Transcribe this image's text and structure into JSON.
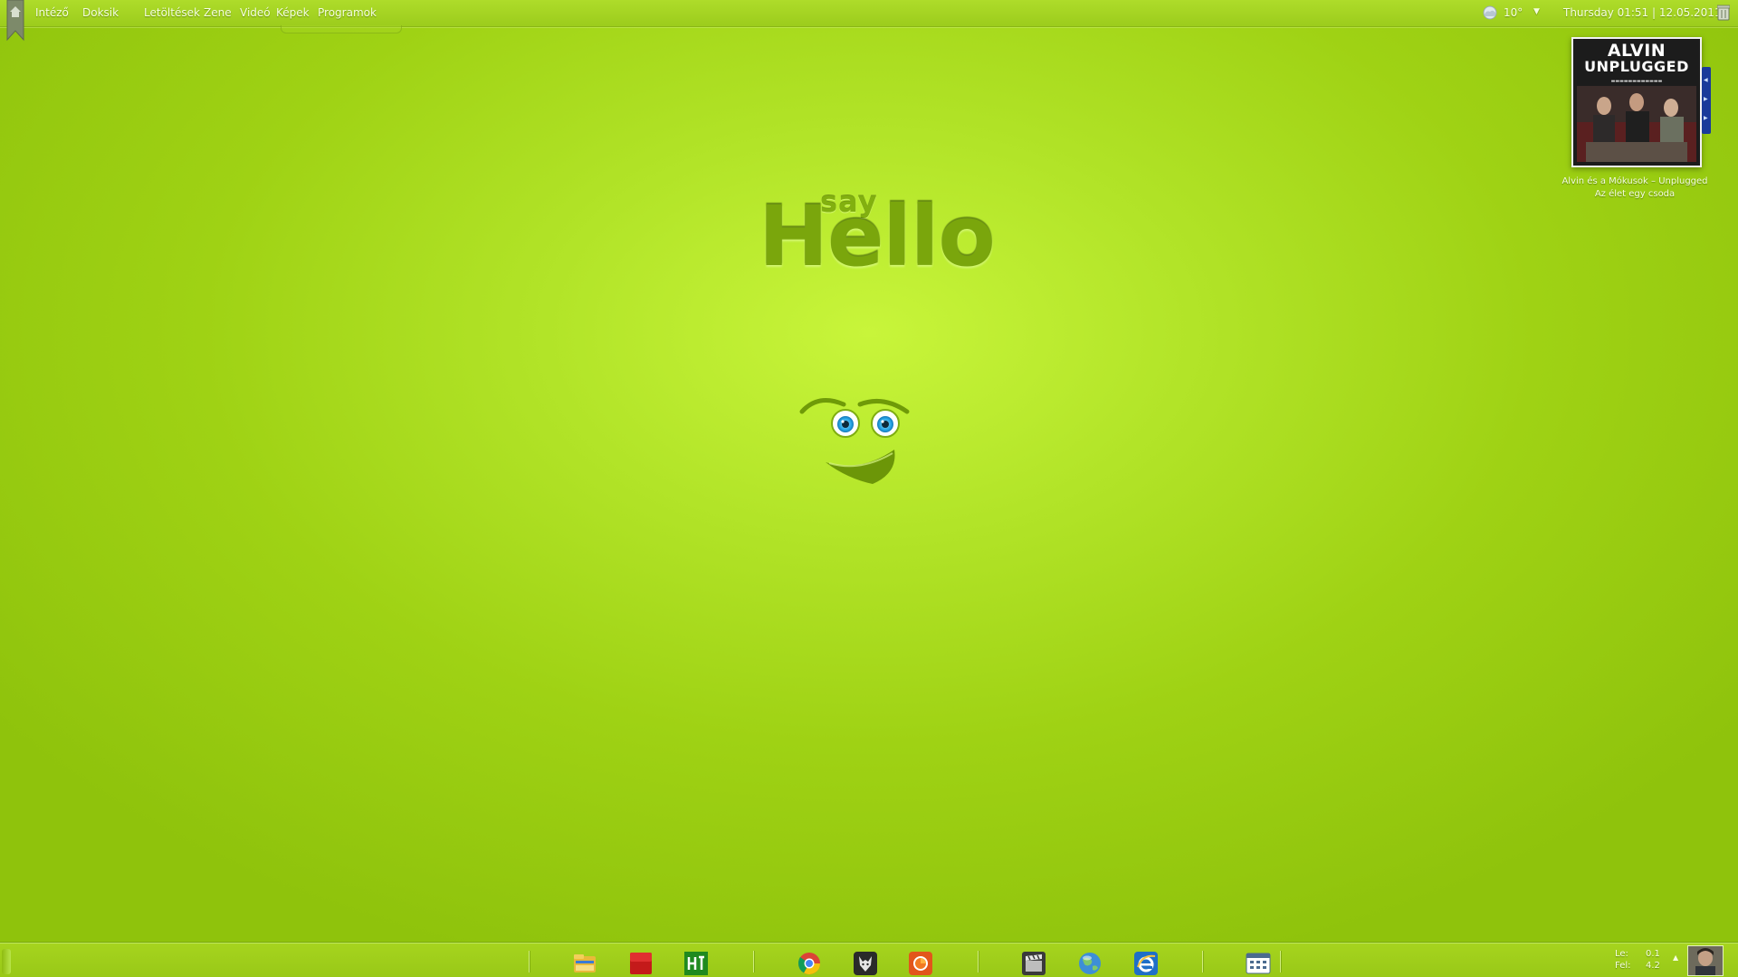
{
  "menubar": {
    "items": [
      {
        "label": "Intéző"
      },
      {
        "label": "Doksik"
      },
      {
        "label": "Letöltések"
      },
      {
        "label": "Zene"
      },
      {
        "label": "Videó"
      },
      {
        "label": "Képek"
      },
      {
        "label": "Programok"
      }
    ]
  },
  "status": {
    "weather_temp": "10°",
    "clock": "Thursday 01:51 | 12.05.2011"
  },
  "now_playing": {
    "cover_title_line1": "ALVIN",
    "cover_title_line2": "UNPLUGGED",
    "line1": "Alvin és a Mókusok – Unplugged",
    "line2": "Az élet egy csoda"
  },
  "wallpaper": {
    "small_word": "say",
    "big_word": "Hello"
  },
  "taskbar": {
    "icons": [
      "file-manager-icon",
      "red-app-icon",
      "green-app-icon",
      "chrome-icon",
      "wolf-app-icon",
      "firefox-icon",
      "video-clapper-icon",
      "globe-icon",
      "internet-explorer-icon",
      "calendar-grid-icon"
    ],
    "net_down_label": "Le:",
    "net_down_value": "0.1",
    "net_up_label": "Fel:",
    "net_up_value": "4.2"
  },
  "colors": {
    "background": "#a6d61a",
    "text": "#f6ffe0",
    "embossed_text": "#7aa60c"
  }
}
